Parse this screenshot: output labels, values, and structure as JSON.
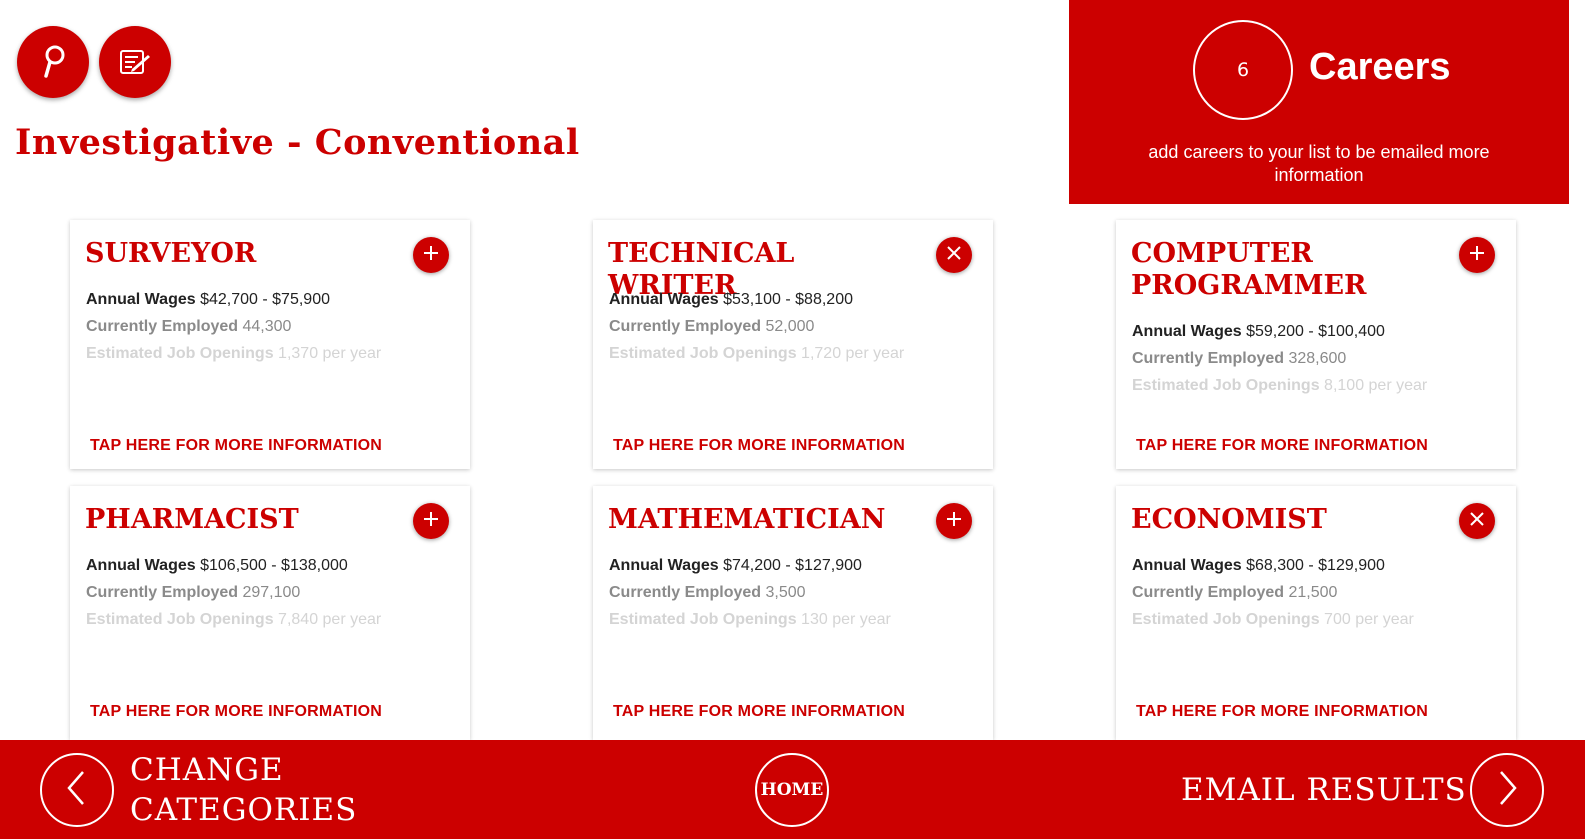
{
  "header": {
    "page_title": "Investigative - Conventional",
    "search_icon": "magnifier-icon",
    "notes_icon": "notepad-pencil-icon"
  },
  "careers_panel": {
    "count": "6",
    "label": "Careers",
    "subtitle": "add careers to your list to be emailed more information"
  },
  "cards": [
    {
      "title": "SURVEYOR",
      "state": "add",
      "wages_label": "Annual Wages",
      "wages": "$42,700 - $75,900",
      "employed_label": "Currently Employed",
      "employed": "44,300",
      "openings_label": "Estimated Job Openings",
      "openings": "1,370 per year",
      "link": "TAP HERE FOR MORE INFORMATION"
    },
    {
      "title": "TECHNICAL WRITER",
      "state": "remove",
      "wages_label": "Annual Wages",
      "wages": "$53,100 - $88,200",
      "employed_label": "Currently Employed",
      "employed": "52,000",
      "openings_label": "Estimated Job Openings",
      "openings": "1,720 per year",
      "link": "TAP HERE FOR MORE INFORMATION"
    },
    {
      "title": "COMPUTER PROGRAMMER",
      "state": "add",
      "wages_label": "Annual Wages",
      "wages": "$59,200 - $100,400",
      "employed_label": "Currently Employed",
      "employed": "328,600",
      "openings_label": "Estimated Job Openings",
      "openings": "8,100 per year",
      "link": "TAP HERE FOR MORE INFORMATION"
    },
    {
      "title": "PHARMACIST",
      "state": "add",
      "wages_label": "Annual Wages",
      "wages": "$106,500 - $138,000",
      "employed_label": "Currently Employed",
      "employed": "297,100",
      "openings_label": "Estimated Job Openings",
      "openings": "7,840 per year",
      "link": "TAP HERE FOR MORE INFORMATION"
    },
    {
      "title": "MATHEMATICIAN",
      "state": "add",
      "wages_label": "Annual Wages",
      "wages": "$74,200 - $127,900",
      "employed_label": "Currently Employed",
      "employed": "3,500",
      "openings_label": "Estimated Job Openings",
      "openings": "130 per year",
      "link": "TAP HERE FOR MORE INFORMATION"
    },
    {
      "title": "ECONOMIST",
      "state": "remove",
      "wages_label": "Annual Wages",
      "wages": "$68,300 - $129,900",
      "employed_label": "Currently Employed",
      "employed": "21,500",
      "openings_label": "Estimated Job Openings",
      "openings": "700 per year",
      "link": "TAP HERE FOR MORE INFORMATION"
    }
  ],
  "footer": {
    "back_line1": "CHANGE",
    "back_line2": "CATEGORIES",
    "home": "HOME",
    "email": "EMAIL RESULTS"
  },
  "colors": {
    "brand_red": "#cc0000",
    "white": "#ffffff"
  }
}
